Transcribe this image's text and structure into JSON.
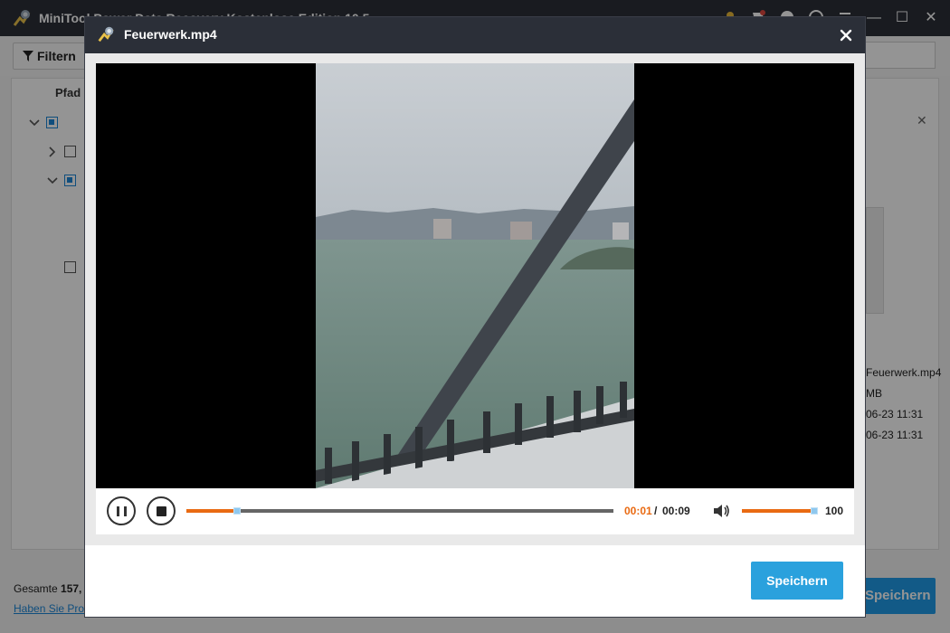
{
  "app": {
    "title": "MiniTool Power Data Recovery Kostenlose Edition 10.5",
    "filter_label": "Filtern",
    "path_label": "Pfad",
    "total_label": "Gesamte",
    "total_value": "157,",
    "help_link": "Haben Sie Probleme?",
    "bg_save_label": "Speichern",
    "detail": {
      "filename": "Feuerwerk.mp4",
      "size": "MB",
      "created": "06-23 11:31",
      "modified": "06-23 11:31"
    }
  },
  "modal": {
    "title": "Feuerwerk.mp4",
    "save_label": "Speichern"
  },
  "player": {
    "current_time": "00:01",
    "separator": "/",
    "total_time": "00:09",
    "progress_fraction": 0.119,
    "volume": "100",
    "volume_fraction": 1.0
  },
  "colors": {
    "titlebar": "#2b2f38",
    "accent_orange": "#e96a12",
    "save_blue": "#2aa1dd"
  },
  "icons": {
    "close": "close-icon",
    "pause": "pause-icon",
    "stop": "stop-icon",
    "volume": "speaker-icon",
    "logo": "minitool-logo-icon"
  }
}
